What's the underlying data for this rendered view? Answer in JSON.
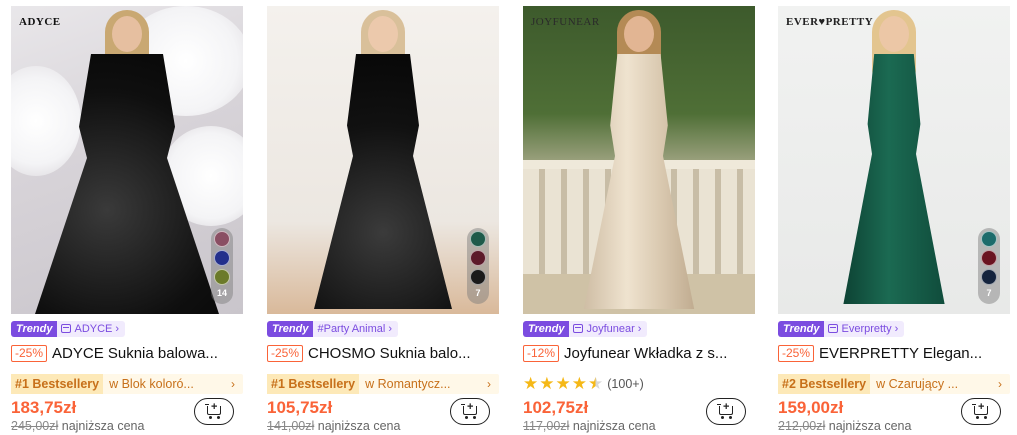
{
  "products": [
    {
      "brand_logo": "ADYCE",
      "swatch_colors": [
        "#8a4f63",
        "#23308c",
        "#6b7a2a"
      ],
      "swatch_count": "14",
      "trendy_label": "Trendy",
      "store_name": "ADYCE",
      "discount": "-25%",
      "title": "ADYCE Suknia balowa...",
      "best_badge": "#1 Bestsellery",
      "best_category": "w Blok koloró...",
      "price": "183,75zł",
      "old_price": "245,00zł",
      "old_price_note": "najniższa cena"
    },
    {
      "brand_logo": "",
      "swatch_colors": [
        "#1e5a4a",
        "#5c1a2a",
        "#1a1a1a"
      ],
      "swatch_count": "7",
      "trendy_label": "Trendy",
      "store_name": "#Party Animal",
      "discount": "-25%",
      "title": "CHOSMO Suknia balo...",
      "best_badge": "#1 Bestsellery",
      "best_category": "w Romantycz...",
      "price": "105,75zł",
      "old_price": "141,00zł",
      "old_price_note": "najniższa cena"
    },
    {
      "brand_logo": "JOYFUNEAR",
      "swatch_colors": [],
      "swatch_count": "",
      "trendy_label": "Trendy",
      "store_name": "Joyfunear",
      "discount": "-12%",
      "title": "Joyfunear Wkładka z s...",
      "rating_value": 4.5,
      "rating_count": "(100+)",
      "price": "102,75zł",
      "old_price": "117,00zł",
      "old_price_note": "najniższa cena"
    },
    {
      "brand_logo": "EVER♥PRETTY",
      "swatch_colors": [
        "#1c6b6b",
        "#6a1320",
        "#14233d"
      ],
      "swatch_count": "7",
      "trendy_label": "Trendy",
      "store_name": "Everpretty",
      "discount": "-25%",
      "title": "EVERPRETTY Elegan...",
      "best_badge": "#2 Bestsellery",
      "best_category": "w Czarujący ...",
      "price": "159,00zł",
      "old_price": "212,00zł",
      "old_price_note": "najniższa cena"
    }
  ],
  "icons": {
    "store": "store-icon",
    "chevron": "chevron-right-icon",
    "cart": "add-to-cart-icon",
    "star": "star-icon"
  },
  "colors": {
    "accent_orange": "#fa6338",
    "trendy_purple": "#7b4ce0",
    "bestseller_text": "#c7701a",
    "star": "#f5b817"
  }
}
